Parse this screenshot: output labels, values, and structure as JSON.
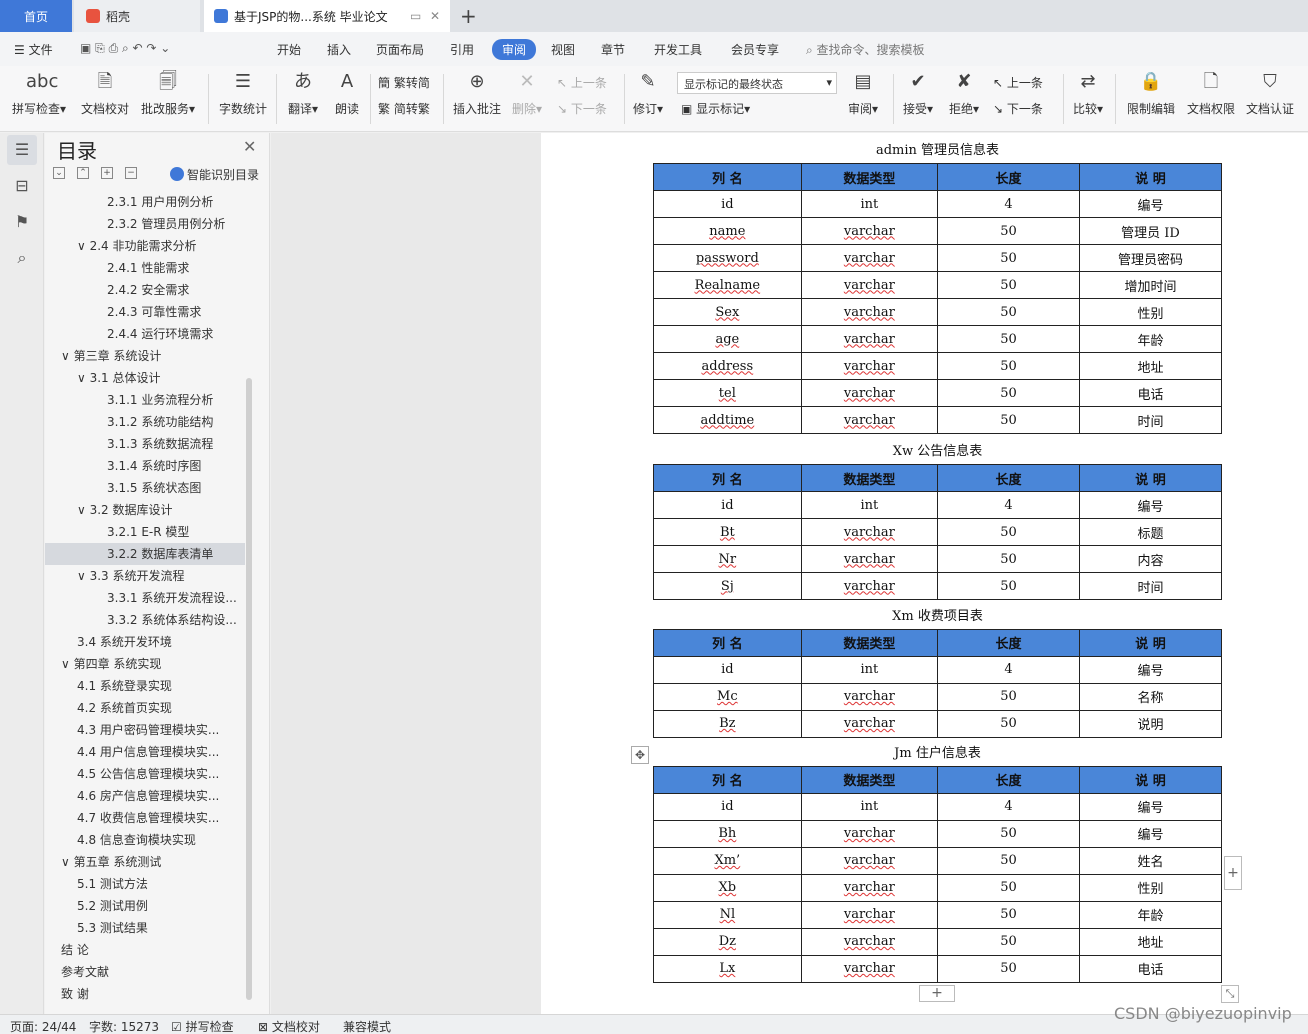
{
  "tabs": {
    "home": "首页",
    "daoke": "稻壳",
    "doc": "基于JSP的物...系统 毕业论文",
    "add": "+"
  },
  "menubar": {
    "file": "文件",
    "items": [
      "开始",
      "插入",
      "页面布局",
      "引用",
      "审阅",
      "视图",
      "章节",
      "开发工具",
      "会员专享"
    ],
    "active": "审阅",
    "search_placeholder": "查找命令、搜索模板"
  },
  "ribbon": {
    "spellcheck": "拼写检查",
    "doc_proof": "文档校对",
    "batch_service": "批改服务",
    "word_count": "字数统计",
    "translate": "翻译",
    "read_aloud": "朗读",
    "trad_to_simp": "繁转简",
    "simp_to_trad": "简转繁",
    "insert_comment": "插入批注",
    "delete": "删除",
    "prev_comment": "上一条",
    "next_comment": "下一条",
    "revise": "修订",
    "markup_state": "显示标记的最终状态",
    "show_markup": "显示标记",
    "review": "审阅",
    "accept": "接受",
    "reject": "拒绝",
    "prev_change": "上一条",
    "next_change": "下一条",
    "compare": "比较",
    "restrict_edit": "限制编辑",
    "doc_permission": "文档权限",
    "doc_auth": "文档认证"
  },
  "toc": {
    "title": "目录",
    "smart": "智能识别目录",
    "items": [
      {
        "text": "2.3.1  用户用例分析",
        "level": 3
      },
      {
        "text": "2.3.2  管理员用例分析",
        "level": 3
      },
      {
        "text": "∨ 2.4  非功能需求分析",
        "level": 2
      },
      {
        "text": "2.4.1  性能需求",
        "level": 3
      },
      {
        "text": "2.4.2  安全需求",
        "level": 3
      },
      {
        "text": "2.4.3  可靠性需求",
        "level": 3
      },
      {
        "text": "2.4.4  运行环境需求",
        "level": 3
      },
      {
        "text": "∨ 第三章  系统设计",
        "level": 1
      },
      {
        "text": "∨ 3.1  总体设计",
        "level": 2
      },
      {
        "text": "3.1.1  业务流程分析",
        "level": 3
      },
      {
        "text": "3.1.2  系统功能结构",
        "level": 3
      },
      {
        "text": "3.1.3  系统数据流程",
        "level": 3
      },
      {
        "text": "3.1.4  系统时序图",
        "level": 3
      },
      {
        "text": "3.1.5  系统状态图",
        "level": 3
      },
      {
        "text": "∨ 3.2  数据库设计",
        "level": 2
      },
      {
        "text": "3.2.1 E-R 模型",
        "level": 3
      },
      {
        "text": "3.2.2  数据库表清单",
        "level": 3,
        "selected": true
      },
      {
        "text": "∨ 3.3  系统开发流程",
        "level": 2
      },
      {
        "text": "3.3.1  系统开发流程设...",
        "level": 3
      },
      {
        "text": "3.3.2  系统体系结构设...",
        "level": 3
      },
      {
        "text": "3.4  系统开发环境",
        "level": 2
      },
      {
        "text": "∨ 第四章  系统实现",
        "level": 1
      },
      {
        "text": "4.1  系统登录实现",
        "level": 2
      },
      {
        "text": "4.2  系统首页实现",
        "level": 2
      },
      {
        "text": "4.3  用户密码管理模块实...",
        "level": 2
      },
      {
        "text": "4.4  用户信息管理模块实...",
        "level": 2
      },
      {
        "text": "4.5  公告信息管理模块实...",
        "level": 2
      },
      {
        "text": "4.6  房产信息管理模块实...",
        "level": 2
      },
      {
        "text": "4.7  收费信息管理模块实...",
        "level": 2
      },
      {
        "text": "4.8  信息查询模块实现",
        "level": 2
      },
      {
        "text": "∨ 第五章  系统测试",
        "level": 1
      },
      {
        "text": "5.1  测试方法",
        "level": 2
      },
      {
        "text": "5.2  测试用例",
        "level": 2
      },
      {
        "text": "5.3  测试结果",
        "level": 2
      },
      {
        "text": "结      论",
        "level": 1
      },
      {
        "text": "参考文献",
        "level": 1
      },
      {
        "text": "致      谢",
        "level": 1
      }
    ]
  },
  "document": {
    "headers": [
      "列    名",
      "数据类型",
      "长度",
      "说    明"
    ],
    "tables": [
      {
        "caption": "admin 管理员信息表",
        "rows": [
          [
            "id",
            "int",
            "4",
            "编号"
          ],
          [
            "name",
            "varchar",
            "50",
            "管理员 ID"
          ],
          [
            "password",
            "varchar",
            "50",
            "管理员密码"
          ],
          [
            "Realname",
            "varchar",
            "50",
            "增加时间"
          ],
          [
            "Sex",
            "varchar",
            "50",
            "性别"
          ],
          [
            "age",
            "varchar",
            "50",
            "年龄"
          ],
          [
            "address",
            "varchar",
            "50",
            "地址"
          ],
          [
            "tel",
            "varchar",
            "50",
            "电话"
          ],
          [
            "addtime",
            "varchar",
            "50",
            "时间"
          ]
        ]
      },
      {
        "caption": "Xw 公告信息表",
        "rows": [
          [
            "id",
            "int",
            "4",
            "编号"
          ],
          [
            "Bt",
            "varchar",
            "50",
            "标题"
          ],
          [
            "Nr",
            "varchar",
            "50",
            "内容"
          ],
          [
            "Sj",
            "varchar",
            "50",
            "时间"
          ]
        ]
      },
      {
        "caption": "Xm 收费项目表",
        "rows": [
          [
            "id",
            "int",
            "4",
            "编号"
          ],
          [
            "Mc",
            "varchar",
            "50",
            "名称"
          ],
          [
            "Bz",
            "varchar",
            "50",
            "说明"
          ]
        ]
      },
      {
        "caption": "Jm 住户信息表",
        "rows": [
          [
            "id",
            "int",
            "4",
            "编号"
          ],
          [
            "Bh",
            "varchar",
            "50",
            "编号"
          ],
          [
            "Xm’",
            "varchar",
            "50",
            "姓名"
          ],
          [
            "Xb",
            "varchar",
            "50",
            "性别"
          ],
          [
            "Nl",
            "varchar",
            "50",
            "年龄"
          ],
          [
            "Dz",
            "varchar",
            "50",
            "地址"
          ],
          [
            "Lx",
            "varchar",
            "50",
            "电话"
          ]
        ]
      }
    ]
  },
  "statusbar": {
    "page": "页面: 24/44",
    "words": "字数: 15273",
    "spellcheck": "拼写检查",
    "proof": "文档校对",
    "compat": "兼容模式"
  },
  "watermark": "CSDN @biyezuopinvip",
  "colors": {
    "accent": "#3f78d8",
    "table_header": "#4a86d8"
  }
}
